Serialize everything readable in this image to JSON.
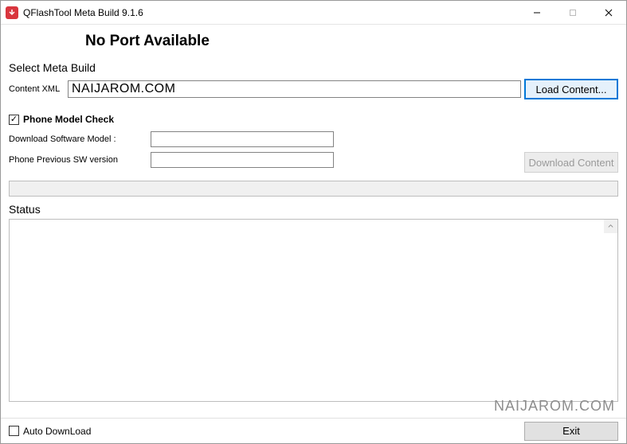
{
  "window": {
    "title": "QFlashTool Meta Build 9.1.6"
  },
  "header": {
    "message": "No Port Available"
  },
  "meta_build": {
    "section_label": "Select Meta Build",
    "content_xml_label": "Content XML",
    "content_xml_value": "NAIJAROM.COM",
    "load_button": "Load Content..."
  },
  "phone_check": {
    "checkbox_label": "Phone Model Check",
    "checked": true,
    "download_model_label": "Download Software  Model :",
    "download_model_value": "",
    "prev_sw_label": "Phone Previous  SW version",
    "prev_sw_value": "",
    "download_button": "Download Content"
  },
  "status": {
    "label": "Status"
  },
  "footer": {
    "auto_download_label": "Auto DownLoad",
    "auto_download_checked": false,
    "exit_button": "Exit"
  },
  "watermark": "NAIJAROM.COM"
}
